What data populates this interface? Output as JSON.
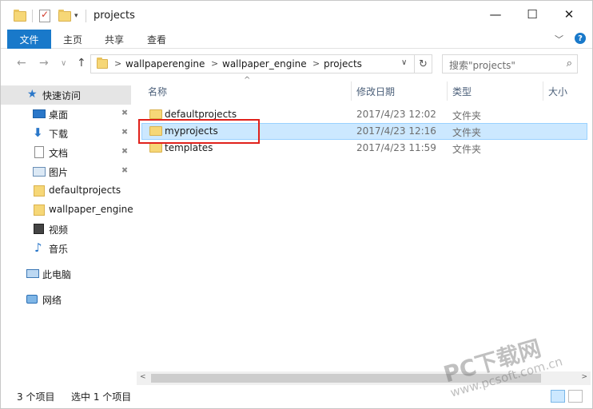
{
  "window": {
    "title": "projects",
    "controls": {
      "minimize": "—",
      "maximize": "☐",
      "close": "✕"
    }
  },
  "ribbon": {
    "file_tab": "文件",
    "tabs": [
      "主页",
      "共享",
      "查看"
    ],
    "collapse_chevron": "﹀",
    "help": "?"
  },
  "nav": {
    "back": "←",
    "forward": "→",
    "recent": "∨",
    "up": "↑"
  },
  "address": {
    "crumbs": [
      "wallpaperengine",
      "wallpaper_engine",
      "projects"
    ],
    "separator": ">",
    "dropdown": "∨",
    "refresh": "↻"
  },
  "search": {
    "placeholder": "搜索\"projects\"",
    "icon": "⌕"
  },
  "sidebar": {
    "items": [
      {
        "label": "快速访问",
        "icon": "star-icon",
        "selected": true
      },
      {
        "label": "桌面",
        "icon": "desktop-icon",
        "pinned": true
      },
      {
        "label": "下载",
        "icon": "download-icon",
        "pinned": true
      },
      {
        "label": "文档",
        "icon": "document-icon",
        "pinned": true
      },
      {
        "label": "图片",
        "icon": "pictures-icon",
        "pinned": true
      },
      {
        "label": "defaultprojects",
        "icon": "folder-icon"
      },
      {
        "label": "wallpaper_engine",
        "icon": "folder-icon"
      },
      {
        "label": "视频",
        "icon": "video-icon"
      },
      {
        "label": "音乐",
        "icon": "music-icon"
      },
      {
        "label": "此电脑",
        "icon": "computer-icon"
      },
      {
        "label": "网络",
        "icon": "network-icon"
      }
    ],
    "pin_glyph": "📌"
  },
  "columns": {
    "name": "名称",
    "date": "修改日期",
    "type": "类型",
    "size": "大小",
    "sort_indicator": "^"
  },
  "files": [
    {
      "name": "defaultprojects",
      "date": "2017/4/23 12:02",
      "type": "文件夹",
      "selected": false
    },
    {
      "name": "myprojects",
      "date": "2017/4/23 12:16",
      "type": "文件夹",
      "selected": true
    },
    {
      "name": "templates",
      "date": "2017/4/23 11:59",
      "type": "文件夹",
      "selected": false
    }
  ],
  "scrollbar": {
    "left": "<",
    "right": ">"
  },
  "status": {
    "item_count": "3 个项目",
    "selected_count": "选中 1 个项目"
  },
  "watermark": {
    "line1": "PC下载网",
    "line2": "www.pcsoft.com.cn"
  },
  "colors": {
    "accent": "#1979ca",
    "selection_bg": "#cce8ff",
    "highlight_border": "#e0211b",
    "folder": "#f6d777"
  }
}
